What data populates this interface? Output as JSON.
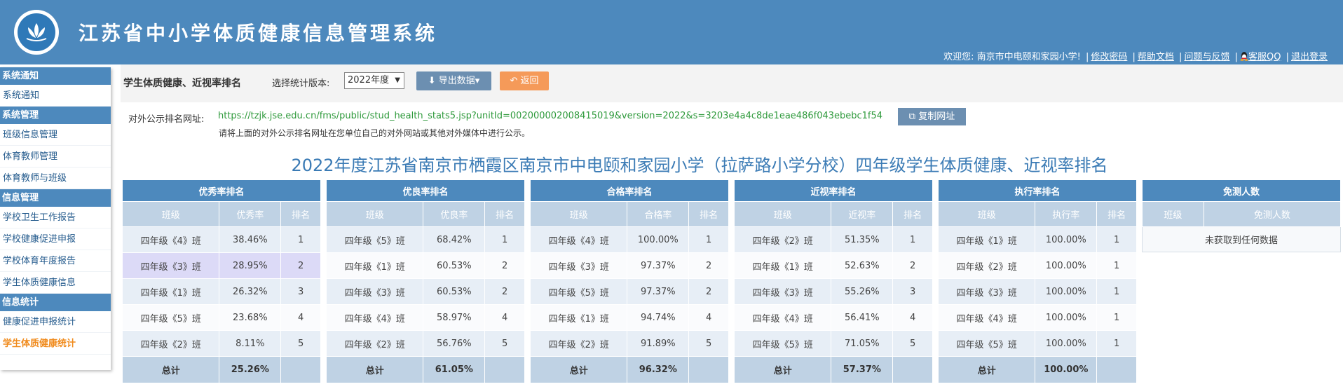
{
  "app": {
    "title": "江苏省中小学体质健康信息管理系统",
    "userbar": {
      "welcome": "欢迎您: 南京市中电颐和家园小学!",
      "links": [
        "修改密码",
        "帮助文档",
        "问题与反馈",
        "客服QQ",
        "退出登录"
      ]
    }
  },
  "sidebar": {
    "sections": [
      {
        "title": "系统通知",
        "items": [
          "系统通知"
        ]
      },
      {
        "title": "系统管理",
        "items": [
          "班级信息管理",
          "体育教师管理",
          "体育教师与班级"
        ]
      },
      {
        "title": "信息管理",
        "items": [
          "学校卫生工作报告",
          "学校健康促进申报",
          "学校体育年度报告",
          "学生体质健康信息"
        ]
      },
      {
        "title": "信息统计",
        "items": [
          "健康促进申报统计",
          "学生体质健康统计"
        ]
      }
    ],
    "active_item": "学生体质健康统计"
  },
  "toolbar": {
    "title": "学生体质健康、近视率排名",
    "version_label": "选择统计版本:",
    "version_value": "2022年度",
    "export_label": "导出数据",
    "back_label": "返回"
  },
  "public_url": {
    "label": "对外公示排名网址:",
    "url": "https://tzjk.jse.edu.cn/fms/public/stud_health_stats5.jsp?unitId=002000002008415019&version=2022&s=3203e4a4c8de1eae486f043ebebc1f54",
    "copy_label": "复制网址",
    "note": "请将上面的对外公示排名网址在您单位自己的对外网站或其他对外媒体中进行公示。"
  },
  "page_heading": "2022年度江苏省南京市栖霞区南京市中电颐和家园小学（拉萨路小学分校）四年级学生体质健康、近视率排名",
  "tables": {
    "excellent": {
      "caption": "优秀率排名",
      "headers": [
        "班级",
        "优秀率",
        "排名"
      ],
      "rows": [
        [
          "四年级《4》班",
          "38.46%",
          "1"
        ],
        [
          "四年级《3》班",
          "28.95%",
          "2"
        ],
        [
          "四年级《1》班",
          "26.32%",
          "3"
        ],
        [
          "四年级《5》班",
          "23.68%",
          "4"
        ],
        [
          "四年级《2》班",
          "8.11%",
          "5"
        ]
      ],
      "total": [
        "总计",
        "25.26%",
        ""
      ]
    },
    "good": {
      "caption": "优良率排名",
      "headers": [
        "班级",
        "优良率",
        "排名"
      ],
      "rows": [
        [
          "四年级《5》班",
          "68.42%",
          "1"
        ],
        [
          "四年级《1》班",
          "60.53%",
          "2"
        ],
        [
          "四年级《3》班",
          "60.53%",
          "2"
        ],
        [
          "四年级《4》班",
          "58.97%",
          "4"
        ],
        [
          "四年级《2》班",
          "56.76%",
          "5"
        ]
      ],
      "total": [
        "总计",
        "61.05%",
        ""
      ]
    },
    "pass": {
      "caption": "合格率排名",
      "headers": [
        "班级",
        "合格率",
        "排名"
      ],
      "rows": [
        [
          "四年级《4》班",
          "100.00%",
          "1"
        ],
        [
          "四年级《3》班",
          "97.37%",
          "2"
        ],
        [
          "四年级《5》班",
          "97.37%",
          "2"
        ],
        [
          "四年级《1》班",
          "94.74%",
          "4"
        ],
        [
          "四年级《2》班",
          "91.89%",
          "5"
        ]
      ],
      "total": [
        "总计",
        "96.32%",
        ""
      ]
    },
    "myopia": {
      "caption": "近视率排名",
      "headers": [
        "班级",
        "近视率",
        "排名"
      ],
      "rows": [
        [
          "四年级《2》班",
          "51.35%",
          "1"
        ],
        [
          "四年级《1》班",
          "52.63%",
          "2"
        ],
        [
          "四年级《3》班",
          "55.26%",
          "3"
        ],
        [
          "四年级《4》班",
          "56.41%",
          "4"
        ],
        [
          "四年级《5》班",
          "71.05%",
          "5"
        ]
      ],
      "total": [
        "总计",
        "57.37%",
        ""
      ]
    },
    "execution": {
      "caption": "执行率排名",
      "headers": [
        "班级",
        "执行率",
        "排名"
      ],
      "rows": [
        [
          "四年级《1》班",
          "100.00%",
          "1"
        ],
        [
          "四年级《2》班",
          "100.00%",
          "1"
        ],
        [
          "四年级《3》班",
          "100.00%",
          "1"
        ],
        [
          "四年级《4》班",
          "100.00%",
          "1"
        ],
        [
          "四年级《5》班",
          "100.00%",
          "1"
        ]
      ],
      "total": [
        "总计",
        "100.00%",
        ""
      ]
    },
    "exempt": {
      "caption": "免测人数",
      "headers": [
        "班级",
        "免测人数"
      ],
      "empty_text": "未获取到任何数据"
    }
  },
  "colors": {
    "brand": "#4d89bd",
    "active_menu": "#f08b1d",
    "url_text": "#2f9a3c",
    "back_button": "#f59a59",
    "heading": "#3b7bb5"
  }
}
